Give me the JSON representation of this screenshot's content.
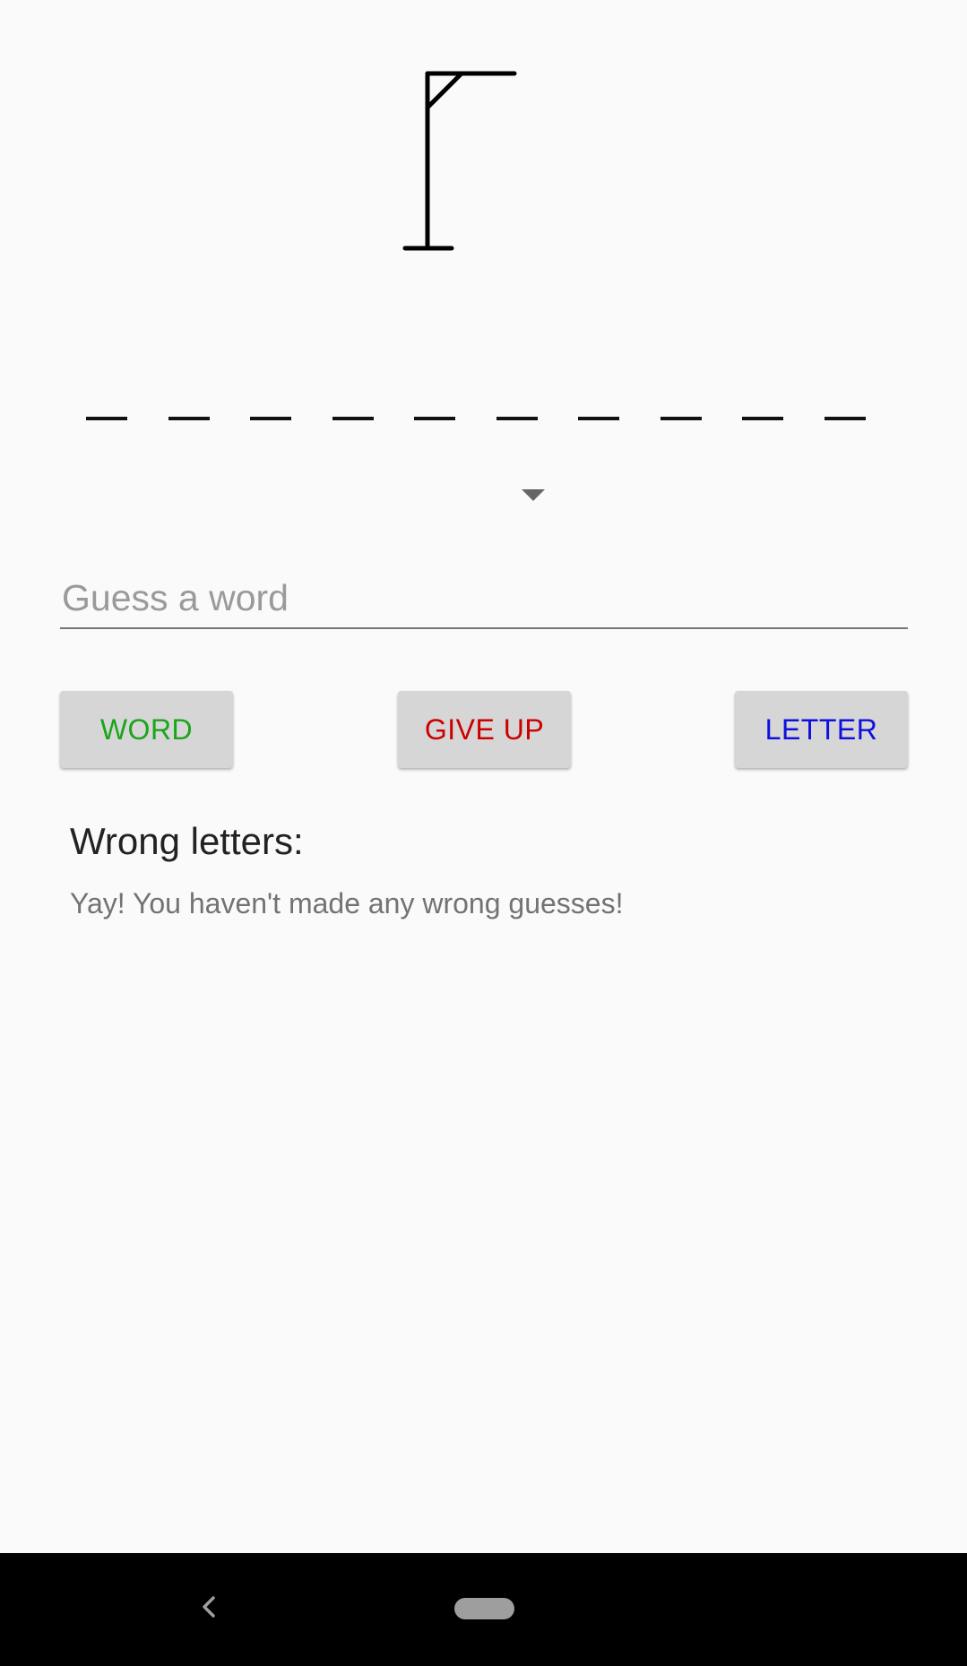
{
  "game": {
    "hangman_stage": 0,
    "word_slots": 10
  },
  "guess": {
    "placeholder": "Guess a word",
    "value": ""
  },
  "buttons": {
    "word_label": "WORD",
    "word_color": "#1aa51a",
    "give_up_label": "GIVE UP",
    "give_up_color": "#cc0000",
    "letter_label": "LETTER",
    "letter_color": "#1010dd"
  },
  "wrong_letters": {
    "title": "Wrong letters:",
    "message": "Yay! You haven't made any wrong guesses!"
  },
  "navigation": {
    "back_icon": "chevron-left-icon",
    "home_icon": "home-pill-icon"
  }
}
